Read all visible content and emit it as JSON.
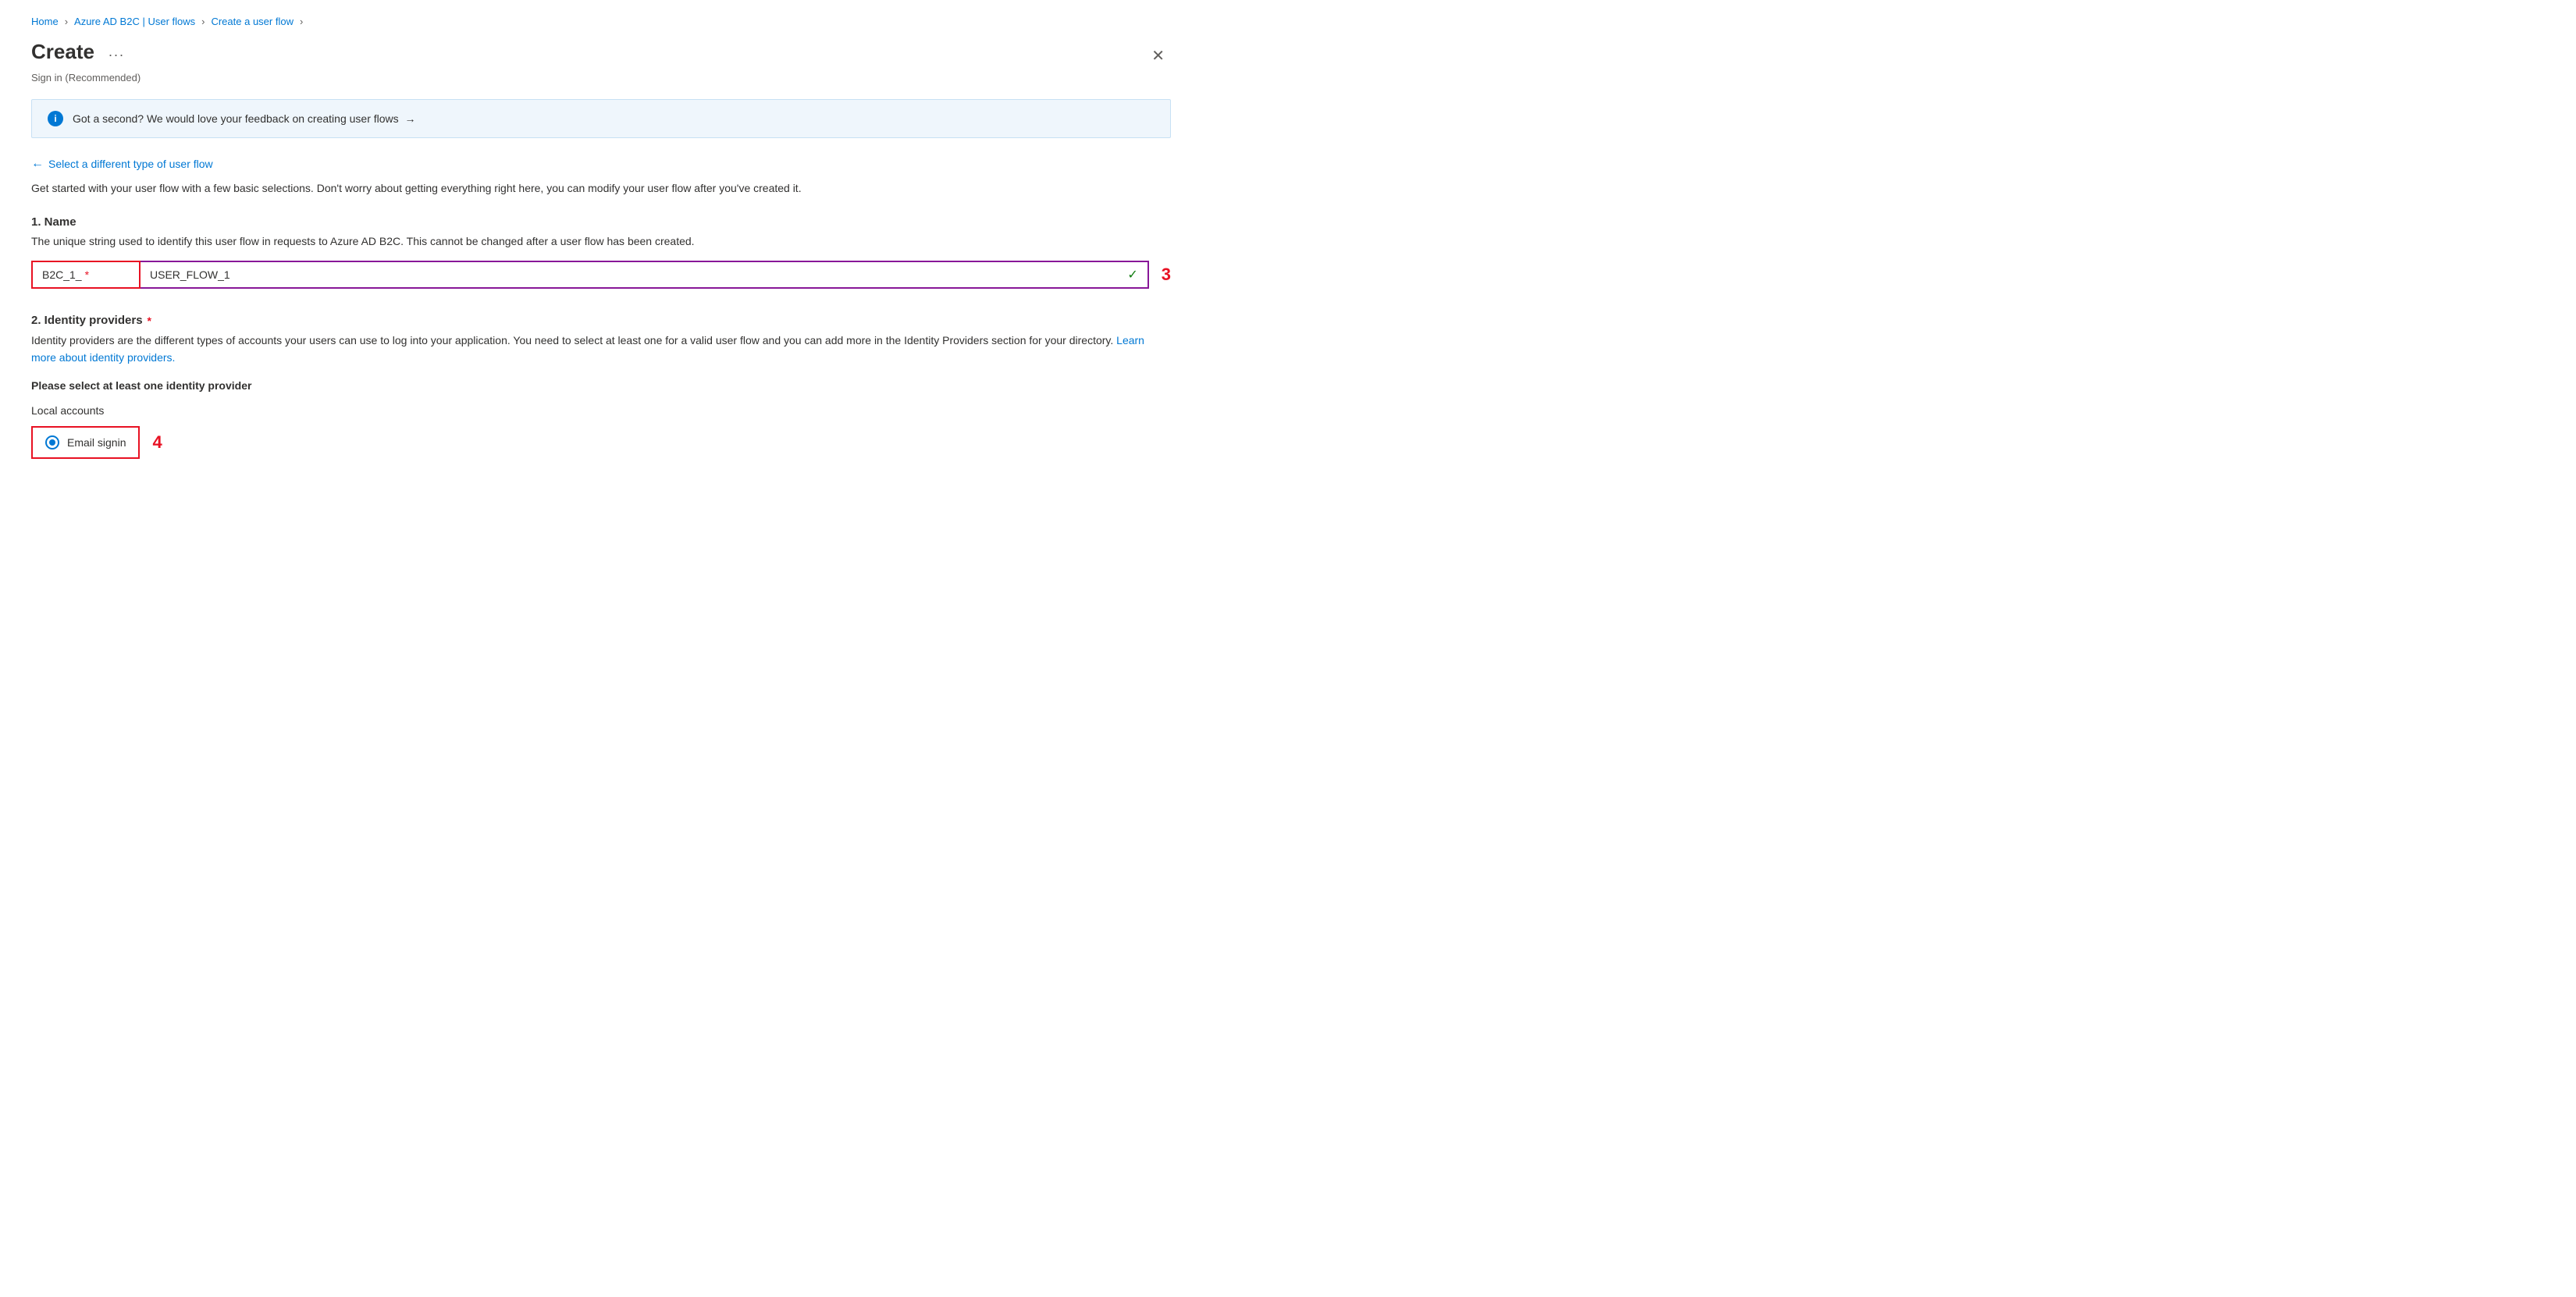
{
  "breadcrumb": {
    "items": [
      {
        "label": "Home",
        "href": "#"
      },
      {
        "label": "Azure AD B2C | User flows",
        "href": "#"
      },
      {
        "label": "Create a user flow",
        "href": "#"
      }
    ],
    "separators": [
      ">",
      ">",
      ">"
    ]
  },
  "header": {
    "title": "Create",
    "ellipsis": "...",
    "subtitle": "Sign in (Recommended)",
    "close_label": "✕"
  },
  "info_banner": {
    "icon_label": "i",
    "text": "Got a second? We would love your feedback on creating user flows",
    "arrow": "→"
  },
  "back_link": {
    "arrow": "←",
    "label": "Select a different type of user flow"
  },
  "description": "Get started with your user flow with a few basic selections. Don't worry about getting everything right here, you can modify your user flow after you've created it.",
  "section1": {
    "title": "1. Name",
    "description": "The unique string used to identify this user flow in requests to Azure AD B2C. This cannot be changed after a user flow has been created.",
    "prefix": "B2C_1_",
    "required_star": "*",
    "input_value": "USER_FLOW_1",
    "input_placeholder": "",
    "check_icon": "✓",
    "annotation": "3"
  },
  "section2": {
    "title": "2. Identity providers",
    "required_star": "*",
    "description_start": "Identity providers are the different types of accounts your users can use to log into your application. You need to select at least one for a valid user flow and you can add more in the Identity Providers section for your directory. ",
    "link_text": "Learn more about identity providers.",
    "link_href": "#",
    "please_select": "Please select at least one identity provider",
    "local_accounts_label": "Local accounts",
    "radio_option": {
      "label": "Email signin",
      "selected": true
    },
    "annotation": "4"
  }
}
